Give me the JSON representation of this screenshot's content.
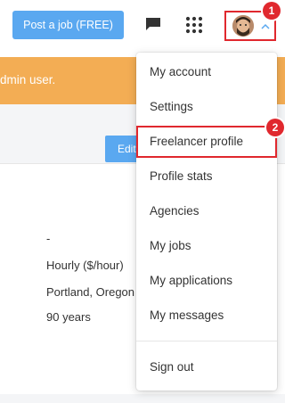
{
  "header": {
    "post_job_label": "Post a job (FREE)",
    "icons": [
      "chat-icon",
      "apps-grid-icon",
      "user-avatar",
      "chevron-up-icon"
    ]
  },
  "banner": {
    "text": "dmin user."
  },
  "toolbar": {
    "edit_label": "Edit"
  },
  "profile": {
    "rows": [
      "-",
      "Hourly ($/hour)",
      "Portland, Oregon",
      "90 years"
    ]
  },
  "menu": {
    "items": [
      "My account",
      "Settings",
      "Freelancer profile",
      "Profile stats",
      "Agencies",
      "My jobs",
      "My applications",
      "My messages",
      "Sign out"
    ],
    "highlighted_index": 2
  },
  "annotations": {
    "badge1": "1",
    "badge2": "2"
  },
  "colors": {
    "primary": "#5aa8f0",
    "banner": "#f3ad54",
    "highlight": "#e0282e"
  }
}
